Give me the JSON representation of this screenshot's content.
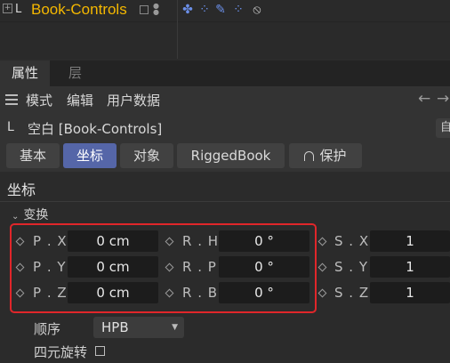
{
  "object_manager": {
    "object_name": "Book-Controls",
    "tag_icons": [
      "xpresso-tag-icon",
      "constraint-tag-icon",
      "pin-tag-icon",
      "constraint-tag-icon",
      "no-entry-icon"
    ]
  },
  "panel_tabs": [
    {
      "label": "属性",
      "active": true
    },
    {
      "label": "层",
      "active": false
    }
  ],
  "menu": {
    "items": [
      "模式",
      "编辑",
      "用户数据"
    ],
    "back_arrow": "←",
    "forward_arrow": "→"
  },
  "object_title": "空白 [Book-Controls]",
  "right_button_glyph": "自",
  "property_tabs": [
    {
      "label": "基本",
      "active": false
    },
    {
      "label": "坐标",
      "active": true
    },
    {
      "label": "对象",
      "active": false
    },
    {
      "label": "RiggedBook",
      "active": false
    },
    {
      "label": "保护",
      "active": false
    }
  ],
  "section_title": "坐标",
  "group_title": "变换",
  "coordinates": {
    "position": [
      {
        "label": "P . X",
        "value": "0 cm"
      },
      {
        "label": "P . Y",
        "value": "0 cm"
      },
      {
        "label": "P . Z",
        "value": "0 cm"
      }
    ],
    "rotation": [
      {
        "label": "R . H",
        "value": "0 °"
      },
      {
        "label": "R . P",
        "value": "0 °"
      },
      {
        "label": "R . B",
        "value": "0 °"
      }
    ],
    "scale": [
      {
        "label": "S . X",
        "value": "1"
      },
      {
        "label": "S . Y",
        "value": "1"
      },
      {
        "label": "S . Z",
        "value": "1"
      }
    ]
  },
  "order": {
    "label": "顺序",
    "value": "HPB"
  },
  "quaternion": {
    "label": "四元旋转",
    "checked": false
  },
  "colors": {
    "object_name": "#f5b800",
    "active_tab": "#5566a8",
    "highlight_box": "#e0262a"
  }
}
